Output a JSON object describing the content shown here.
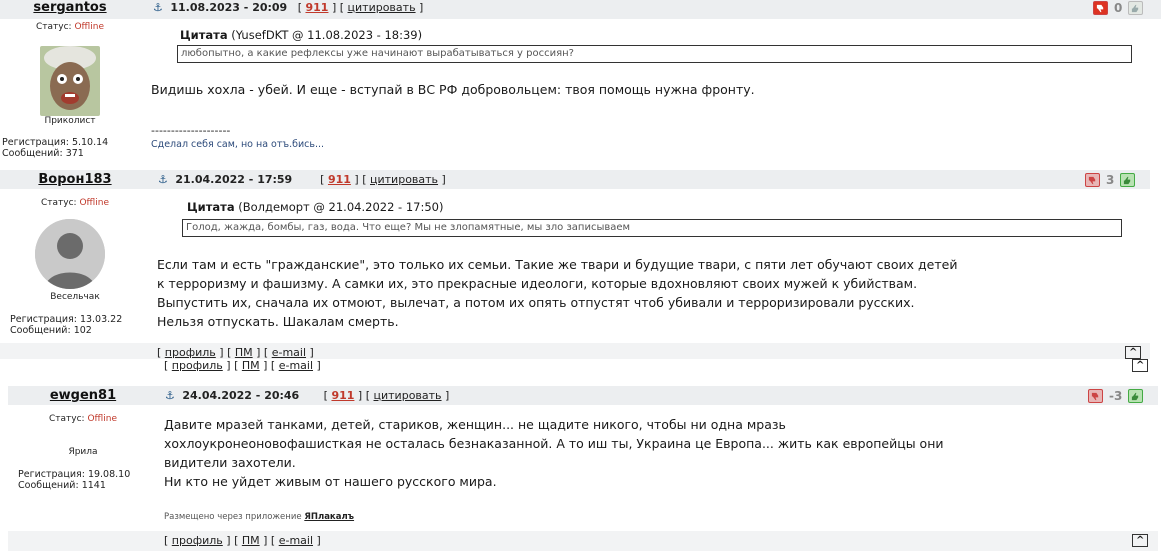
{
  "posts": [
    {
      "username": "sergantos",
      "status_label": "Статус:",
      "status_value": "Offline",
      "rank": "Приколист",
      "reg_label": "Регистрация:",
      "reg_date": "5.10.14",
      "msg_label": "Сообщений:",
      "msg_count": "371",
      "datetime": "11.08.2023 - 20:09",
      "num_link": "911",
      "quote_link": "цитировать",
      "quote_title": "Цитата",
      "quote_meta": "(YusefDKT @ 11.08.2023 - 18:39)",
      "quote_text": "любопытно, а какие рефлексы уже начинают вырабатываться у россиян?",
      "body": [
        "Видишь хохла - убей. И еще - вступай в ВС РФ добровольцем: твоя помощь нужна фронту."
      ],
      "sig_dashes": "--------------------",
      "signature": "Сделал себя сам, но на отъ.бись...",
      "votes": "0"
    },
    {
      "username": "Ворон183",
      "status_label": "Статус:",
      "status_value": "Offline",
      "rank": "Весельчак",
      "reg_label": "Регистрация:",
      "reg_date": "13.03.22",
      "msg_label": "Сообщений:",
      "msg_count": "102",
      "datetime": "21.04.2022 - 17:59",
      "num_link": "911",
      "quote_link": "цитировать",
      "quote_title": "Цитата",
      "quote_meta": "(Волдеморт @ 21.04.2022 - 17:50)",
      "quote_text": "Голод, жажда, бомбы, газ, вода. Что еще? Мы не злопамятные, мы зло записываем",
      "body": [
        "Если там и есть \"гражданские\", это только их семьи. Такие же твари и будущие твари, с пяти лет обучают своих детей",
        "к терроризму и фашизму. А самки их, это прекрасные идеологи, которые вдохновляют своих мужей к убийствам.",
        "Выпустить их, сначала их отмоют, вылечат, а потом их опять отпустят чтоб убивали и терроризировали русских.",
        "Нельзя отпускать. Шакалам смерть."
      ],
      "votes": "3"
    },
    {
      "username": "ewgen81",
      "status_label": "Статус:",
      "status_value": "Offline",
      "rank": "Ярила",
      "reg_label": "Регистрация:",
      "reg_date": "19.08.10",
      "msg_label": "Сообщений:",
      "msg_count": "1141",
      "datetime": "24.04.2022 - 20:46",
      "num_link": "911",
      "quote_link": "цитировать",
      "body": [
        "Давите мразей танками, детей, стариков, женщин... не щадите никого, чтобы ни одна мразь",
        "хохлоукронеоновофашисткая не осталась безнаказанной. А то иш ты, Украина це Европа... жить как европейцы они",
        "видители захотели.",
        "Ни кто не уйдет живым от нашего русского мира."
      ],
      "via_text": "Размещено через приложение",
      "via_app": "ЯПлакалъ",
      "votes": "-3"
    }
  ],
  "links": {
    "profile": "профиль",
    "pm": "ПМ",
    "email": "e-mail",
    "up": "^"
  }
}
